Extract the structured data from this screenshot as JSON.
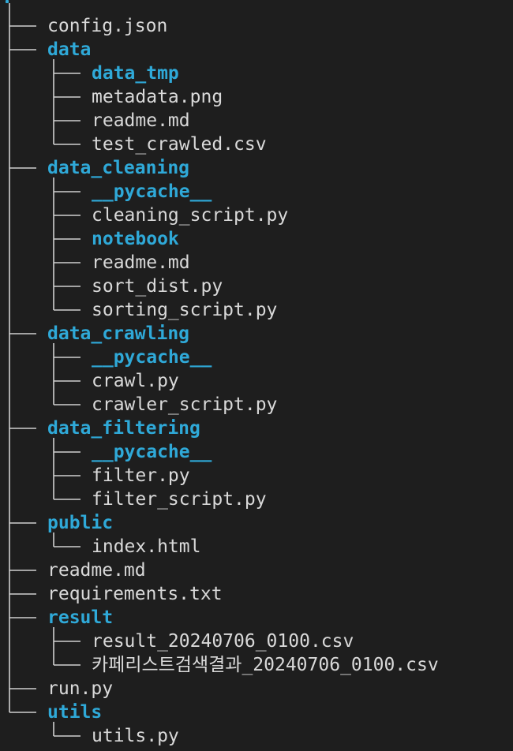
{
  "root_label": ".",
  "entries": [
    {
      "name": "config.json",
      "depth": 0,
      "kind": "file"
    },
    {
      "name": "data",
      "depth": 0,
      "kind": "dir",
      "children": [
        {
          "name": "data_tmp",
          "depth": 1,
          "kind": "dir"
        },
        {
          "name": "metadata.png",
          "depth": 1,
          "kind": "file"
        },
        {
          "name": "readme.md",
          "depth": 1,
          "kind": "file"
        },
        {
          "name": "test_crawled.csv",
          "depth": 1,
          "kind": "file"
        }
      ]
    },
    {
      "name": "data_cleaning",
      "depth": 0,
      "kind": "dir",
      "children": [
        {
          "name": "__pycache__",
          "depth": 1,
          "kind": "dir"
        },
        {
          "name": "cleaning_script.py",
          "depth": 1,
          "kind": "file"
        },
        {
          "name": "notebook",
          "depth": 1,
          "kind": "dir"
        },
        {
          "name": "readme.md",
          "depth": 1,
          "kind": "file"
        },
        {
          "name": "sort_dist.py",
          "depth": 1,
          "kind": "file"
        },
        {
          "name": "sorting_script.py",
          "depth": 1,
          "kind": "file"
        }
      ]
    },
    {
      "name": "data_crawling",
      "depth": 0,
      "kind": "dir",
      "children": [
        {
          "name": "__pycache__",
          "depth": 1,
          "kind": "dir"
        },
        {
          "name": "crawl.py",
          "depth": 1,
          "kind": "file"
        },
        {
          "name": "crawler_script.py",
          "depth": 1,
          "kind": "file"
        }
      ]
    },
    {
      "name": "data_filtering",
      "depth": 0,
      "kind": "dir",
      "children": [
        {
          "name": "__pycache__",
          "depth": 1,
          "kind": "dir"
        },
        {
          "name": "filter.py",
          "depth": 1,
          "kind": "file"
        },
        {
          "name": "filter_script.py",
          "depth": 1,
          "kind": "file"
        }
      ]
    },
    {
      "name": "public",
      "depth": 0,
      "kind": "dir",
      "children": [
        {
          "name": "index.html",
          "depth": 1,
          "kind": "file"
        }
      ]
    },
    {
      "name": "readme.md",
      "depth": 0,
      "kind": "file"
    },
    {
      "name": "requirements.txt",
      "depth": 0,
      "kind": "file"
    },
    {
      "name": "result",
      "depth": 0,
      "kind": "dir",
      "children": [
        {
          "name": "result_20240706_0100.csv",
          "depth": 1,
          "kind": "file"
        },
        {
          "name": "카페리스트검색결과_20240706_0100.csv",
          "depth": 1,
          "kind": "file"
        }
      ]
    },
    {
      "name": "run.py",
      "depth": 0,
      "kind": "file"
    },
    {
      "name": "utils",
      "depth": 0,
      "kind": "dir",
      "children": [
        {
          "name": "utils.py",
          "depth": 1,
          "kind": "file"
        }
      ]
    }
  ],
  "colors": {
    "background": "#1e1e1e",
    "directory": "#2fa9d8",
    "file": "#d9d9d9",
    "guide": "#cfcfcf"
  }
}
